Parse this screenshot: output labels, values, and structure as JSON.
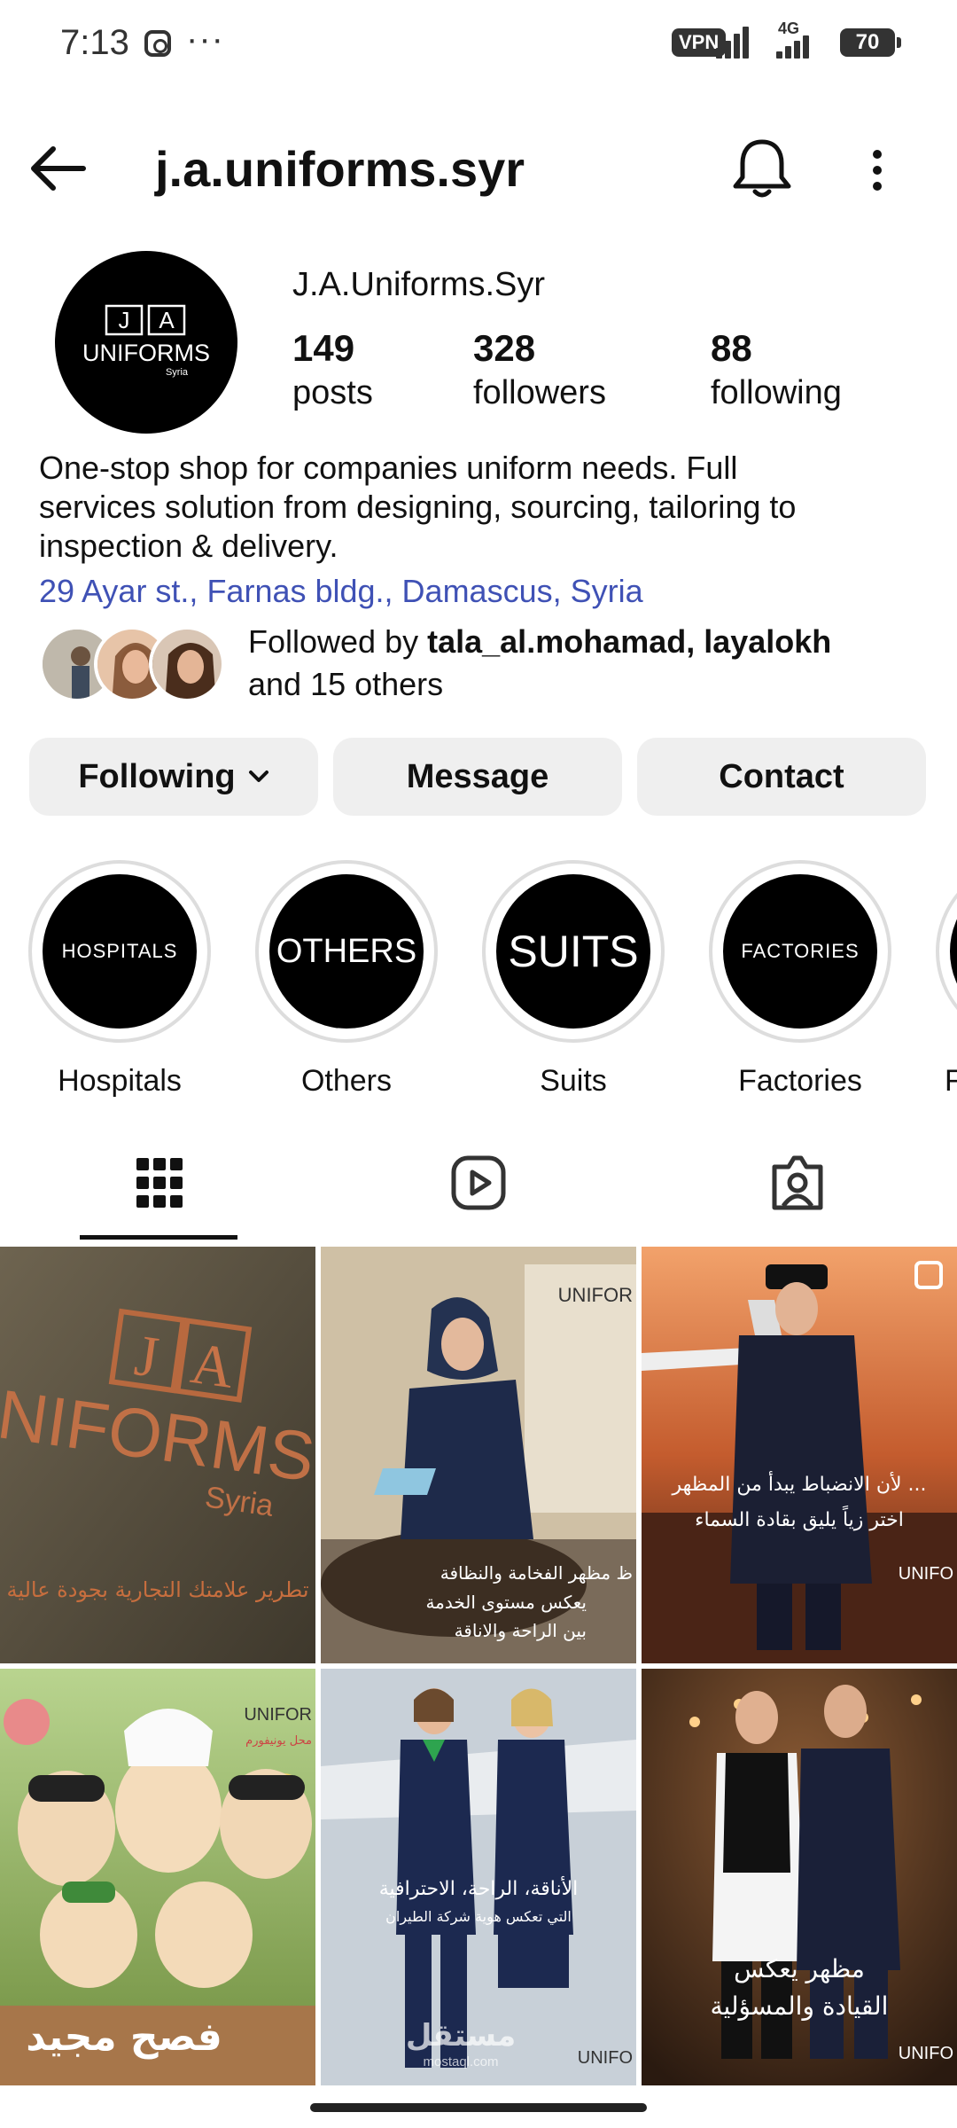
{
  "status_bar": {
    "time": "7:13",
    "dots": "···",
    "vpn": "VPN",
    "network": "4G",
    "battery": "70"
  },
  "header": {
    "title": "j.a.uniforms.syr"
  },
  "profile": {
    "display_name": "J.A.Uniforms.Syr",
    "avatar_text": {
      "line1_a": "J",
      "line1_b": "A",
      "line2": "UNIFORMS",
      "line3": "Syria"
    },
    "stats": [
      {
        "value": "149",
        "label": "posts"
      },
      {
        "value": "328",
        "label": "followers"
      },
      {
        "value": "88",
        "label": "following"
      }
    ],
    "bio_lines": [
      "One-stop shop for companies uniform needs. Full",
      "services solution from designing, sourcing, tailoring to",
      "inspection & delivery."
    ],
    "address": "29 Ayar st., Farnas bldg., Damascus, Syria",
    "followed_by": {
      "prefix": "Followed by ",
      "names": "tala_al.mohamad, layalokh",
      "suffix": "and 15 others"
    }
  },
  "actions": {
    "following": "Following",
    "message": "Message",
    "contact": "Contact"
  },
  "highlights": [
    {
      "cover": "HOSPITALS",
      "label": "Hospitals"
    },
    {
      "cover": "OTHERS",
      "label": "Others"
    },
    {
      "cover": "SUITS",
      "label": "Suits"
    },
    {
      "cover": "FACTORIES",
      "label": "Factories"
    },
    {
      "cover": "",
      "label": "F"
    }
  ],
  "tabs": [
    {
      "icon": "grid-icon",
      "active": true
    },
    {
      "icon": "reels-icon",
      "active": false
    },
    {
      "icon": "tagged-icon",
      "active": false
    }
  ],
  "posts": {
    "p1": {
      "logo_a": "J",
      "logo_b": "A",
      "logo_word": "UNIFORMS",
      "logo_sub": "Syria",
      "caption": "تطرير علامتك التجارية بجودة عالية"
    },
    "p2": {
      "caption1": "ظ مظهر الفخامة والنظافة",
      "caption2": "يعكس مستوى الخدمة",
      "caption3": "بين الراحة والاناقة",
      "brand": "UNIFOR"
    },
    "p3": {
      "caption1": "لأن الانضباط يبدأ من المظهر ...",
      "caption2": "اختر زياً يليق بقادة السماء",
      "brand": "UNIFO"
    },
    "p4": {
      "caption": "فصح مجيد",
      "small": "محل يونيفورم",
      "brand": "UNIFOR"
    },
    "p5": {
      "caption1": "الأناقة، الراحة، الاحترافية",
      "caption2": "التي تعكس هوية شركة الطيران",
      "watermark": "مستقل",
      "watermark_sub": "mostaql.com",
      "brand": "UNIFO"
    },
    "p6": {
      "caption1": "مظهر يعكس",
      "caption2": "القيادة والمسؤلية",
      "brand": "UNIFO"
    }
  },
  "colors": {
    "link": "#3f51b5",
    "button_bg": "#efefef"
  }
}
